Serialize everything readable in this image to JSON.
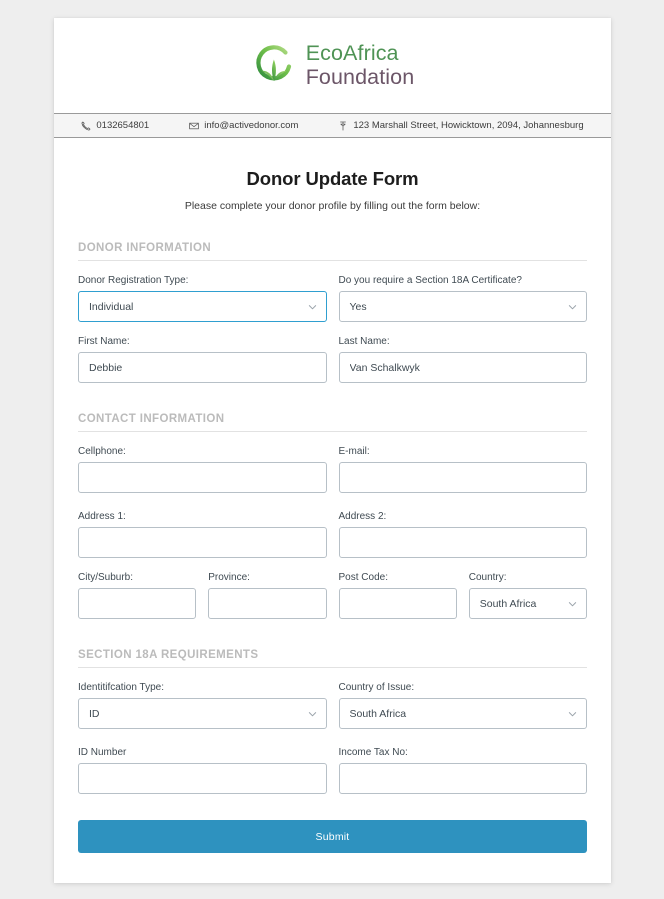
{
  "brand": {
    "logo_line1": "EcoAfrica",
    "logo_line2": "Foundation",
    "green": "#4f9355",
    "plum": "#6c5668"
  },
  "contact_bar": {
    "phone": "0132654801",
    "email": "info@activedonor.com",
    "address": "123 Marshall Street, Howicktown, 2094, Johannesburg",
    "phone_icon": "phone-icon",
    "email_icon": "envelope-icon",
    "address_icon": "map-pin-icon"
  },
  "form": {
    "title": "Donor Update Form",
    "subtitle": "Please complete your donor profile by filling out the form below:",
    "submit_label": "Submit",
    "submit_color": "#2e92bf",
    "sections": [
      {
        "heading": "DONOR INFORMATION",
        "fields": {
          "registration_type": {
            "label": "Donor Registration Type:",
            "value": "Individual"
          },
          "section18a_required": {
            "label": "Do you require a Section 18A Certificate?",
            "value": "Yes"
          },
          "first_name": {
            "label": "First Name:",
            "value": "Debbie",
            "placeholder": ""
          },
          "last_name": {
            "label": "Last Name:",
            "value": "Van Schalkwyk",
            "placeholder": ""
          }
        }
      },
      {
        "heading": "CONTACT INFORMATION",
        "fields": {
          "cellphone": {
            "label": "Cellphone:",
            "value": "",
            "placeholder": ""
          },
          "email": {
            "label": "E-mail:",
            "value": "",
            "placeholder": ""
          },
          "address1": {
            "label": "Address 1:",
            "value": "",
            "placeholder": ""
          },
          "address2": {
            "label": "Address 2:",
            "value": "",
            "placeholder": ""
          },
          "city": {
            "label": "City/Suburb:",
            "value": "",
            "placeholder": ""
          },
          "province": {
            "label": "Province:",
            "value": "",
            "placeholder": ""
          },
          "postcode": {
            "label": "Post Code:",
            "value": "",
            "placeholder": ""
          },
          "country": {
            "label": "Country:",
            "value": "South Africa"
          }
        }
      },
      {
        "heading": "SECTION 18A REQUIREMENTS",
        "fields": {
          "id_type": {
            "label": "Identitifcation Type:",
            "value": "ID"
          },
          "country_of_issue": {
            "label": "Country of Issue:",
            "value": "South Africa"
          },
          "id_number": {
            "label": "ID Number",
            "value": "",
            "placeholder": ""
          },
          "income_tax_no": {
            "label": "Income Tax No:",
            "value": "",
            "placeholder": ""
          }
        }
      }
    ]
  }
}
